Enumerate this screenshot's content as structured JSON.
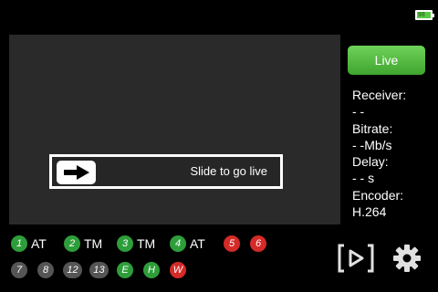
{
  "status_bar": {
    "battery_text": "98",
    "battery_level": 0.98
  },
  "slider": {
    "label": "Slide to go live"
  },
  "live_button": {
    "label": "Live"
  },
  "stats": {
    "receiver_label": "Receiver:",
    "receiver_value": "- -",
    "bitrate_label": "Bitrate:",
    "bitrate_value": "- -Mb/s",
    "delay_label": "Delay:",
    "delay_value": "- - s",
    "encoder_label": "Encoder:",
    "encoder_value": "H.264"
  },
  "channels_row1": [
    {
      "num": "1",
      "label": "AT",
      "status": "ok"
    },
    {
      "num": "2",
      "label": "TM",
      "status": "ok"
    },
    {
      "num": "3",
      "label": "TM",
      "status": "ok"
    },
    {
      "num": "4",
      "label": "AT",
      "status": "ok"
    },
    {
      "num": "5",
      "label": "",
      "status": "error"
    },
    {
      "num": "6",
      "label": "",
      "status": "error"
    }
  ],
  "channels_row2": [
    {
      "num": "7",
      "status": "off"
    },
    {
      "num": "8",
      "status": "off"
    },
    {
      "num": "12",
      "status": "off"
    },
    {
      "num": "13",
      "status": "off"
    },
    {
      "num": "E",
      "status": "ok"
    },
    {
      "num": "H",
      "status": "ok"
    },
    {
      "num": "W",
      "status": "error"
    }
  ],
  "colors": {
    "ok": "#2e9e3a",
    "error": "#d42a28",
    "off": "#555555",
    "live": "#4cb83a"
  },
  "icons": {
    "play": "play-bracket-icon",
    "settings": "gear-icon",
    "arrow": "arrow-right-icon",
    "battery": "battery-icon"
  }
}
